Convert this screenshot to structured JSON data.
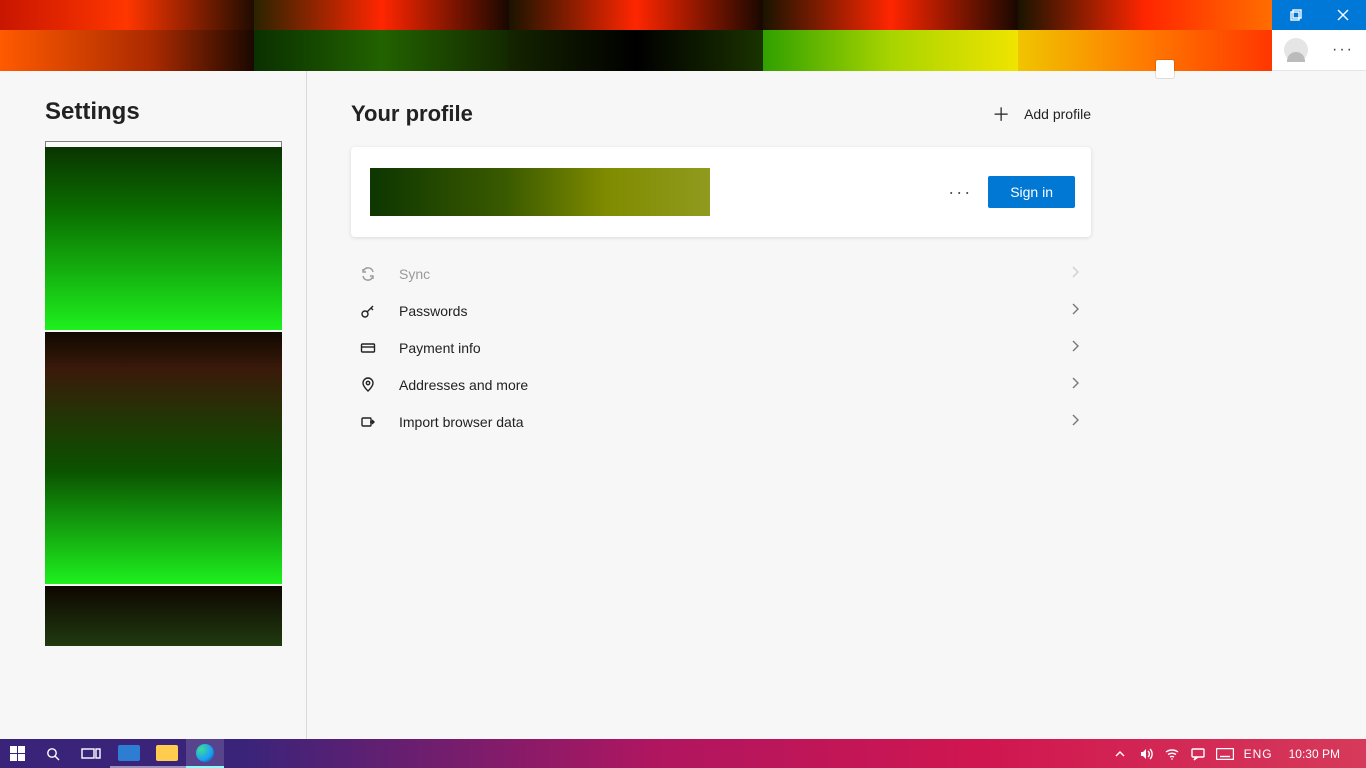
{
  "window_controls": {
    "restore": "",
    "close": ""
  },
  "header": {
    "settings_title": "Settings",
    "page_title": "Your profile",
    "add_profile": "Add profile"
  },
  "profile_card": {
    "signin_label": "Sign in"
  },
  "rows": {
    "sync": {
      "label": "Sync",
      "enabled": false
    },
    "passwords": {
      "label": "Passwords",
      "enabled": true
    },
    "payment": {
      "label": "Payment info",
      "enabled": true
    },
    "addresses": {
      "label": "Addresses and more",
      "enabled": true
    },
    "import": {
      "label": "Import browser data",
      "enabled": true
    }
  },
  "taskbar": {
    "language": "ENG",
    "clock": "10:30 PM"
  }
}
